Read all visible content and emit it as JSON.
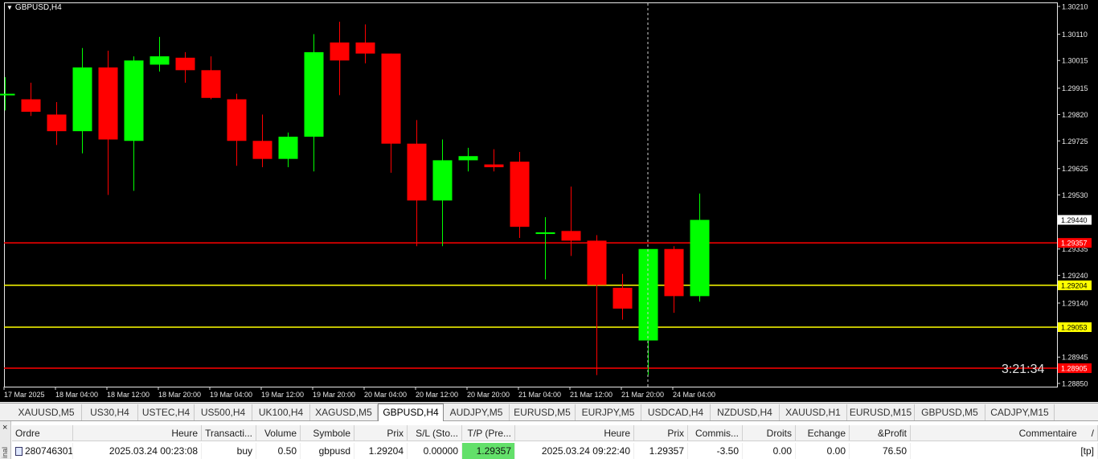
{
  "chart": {
    "symbol_title": "GBPUSD,H4",
    "timer": "3:21:34",
    "colors": {
      "background": "#000000",
      "bull": "#00ff00",
      "bear": "#ff0000",
      "tp_line": "#ff0000",
      "entry_line": "#ffff00",
      "grid": "#ffffff"
    },
    "price_axis": [
      "1.30210",
      "1.30110",
      "1.30015",
      "1.29915",
      "1.29820",
      "1.29725",
      "1.29625",
      "1.29530",
      "1.29441",
      "1.29335",
      "1.29240",
      "1.29140",
      "1.28945",
      "1.28850"
    ],
    "price_tags": [
      {
        "label": "1.29357",
        "price": 1.29357,
        "color": "#ff0000",
        "text": "#ffffff",
        "kind": "tp"
      },
      {
        "label": "1.29204",
        "price": 1.29204,
        "color": "#ffff00",
        "text": "#000000",
        "kind": "entry"
      },
      {
        "label": "1.29053",
        "price": 1.29053,
        "color": "#ffff00",
        "text": "#000000",
        "kind": "entry"
      },
      {
        "label": "1.28905",
        "price": 1.28905,
        "color": "#ff0000",
        "text": "#ffffff",
        "kind": "stop"
      }
    ],
    "time_axis": [
      "17 Mar 2025",
      "18 Mar 04:00",
      "18 Mar 12:00",
      "18 Mar 20:00",
      "19 Mar 04:00",
      "19 Mar 12:00",
      "19 Mar 20:00",
      "20 Mar 04:00",
      "20 Mar 12:00",
      "20 Mar 20:00",
      "21 Mar 04:00",
      "21 Mar 12:00",
      "21 Mar 20:00",
      "24 Mar 04:00"
    ],
    "candles": [
      {
        "o": 1.29895,
        "h": 1.29955,
        "l": 1.29835,
        "c": 1.29895
      },
      {
        "o": 1.29875,
        "h": 1.29935,
        "l": 1.29815,
        "c": 1.2983
      },
      {
        "o": 1.2982,
        "h": 1.29865,
        "l": 1.2971,
        "c": 1.2976
      },
      {
        "o": 1.2976,
        "h": 1.3006,
        "l": 1.2968,
        "c": 1.2999
      },
      {
        "o": 1.2999,
        "h": 1.3005,
        "l": 1.2953,
        "c": 1.2973
      },
      {
        "o": 1.29725,
        "h": 1.3003,
        "l": 1.29545,
        "c": 1.30015
      },
      {
        "o": 1.3,
        "h": 1.301,
        "l": 1.29975,
        "c": 1.3003
      },
      {
        "o": 1.30025,
        "h": 1.30045,
        "l": 1.29935,
        "c": 1.2998
      },
      {
        "o": 1.2998,
        "h": 1.3003,
        "l": 1.29875,
        "c": 1.2988
      },
      {
        "o": 1.29875,
        "h": 1.29895,
        "l": 1.29635,
        "c": 1.29725
      },
      {
        "o": 1.29725,
        "h": 1.2982,
        "l": 1.2963,
        "c": 1.2966
      },
      {
        "o": 1.2966,
        "h": 1.29755,
        "l": 1.2963,
        "c": 1.2974
      },
      {
        "o": 1.2974,
        "h": 1.3011,
        "l": 1.29615,
        "c": 1.30045
      },
      {
        "o": 1.3008,
        "h": 1.30155,
        "l": 1.2989,
        "c": 1.30015
      },
      {
        "o": 1.3008,
        "h": 1.30145,
        "l": 1.30005,
        "c": 1.3004
      },
      {
        "o": 1.3004,
        "h": 1.3004,
        "l": 1.2961,
        "c": 1.29715
      },
      {
        "o": 1.29715,
        "h": 1.298,
        "l": 1.29345,
        "c": 1.2951
      },
      {
        "o": 1.2951,
        "h": 1.2973,
        "l": 1.29345,
        "c": 1.29655
      },
      {
        "o": 1.29655,
        "h": 1.297,
        "l": 1.29615,
        "c": 1.2967
      },
      {
        "o": 1.2964,
        "h": 1.29695,
        "l": 1.29615,
        "c": 1.2963
      },
      {
        "o": 1.2965,
        "h": 1.29685,
        "l": 1.29375,
        "c": 1.29415
      },
      {
        "o": 1.2939,
        "h": 1.2945,
        "l": 1.29225,
        "c": 1.29395
      },
      {
        "o": 1.294,
        "h": 1.2956,
        "l": 1.2931,
        "c": 1.29365
      },
      {
        "o": 1.29365,
        "h": 1.29385,
        "l": 1.2888,
        "c": 1.29205
      },
      {
        "o": 1.29195,
        "h": 1.29245,
        "l": 1.2908,
        "c": 1.2912
      },
      {
        "o": 1.29005,
        "h": 1.29335,
        "l": 1.2888,
        "c": 1.29335
      },
      {
        "o": 1.29335,
        "h": 1.29345,
        "l": 1.29105,
        "c": 1.29165
      },
      {
        "o": 1.29165,
        "h": 1.29535,
        "l": 1.29145,
        "c": 1.2944
      }
    ]
  },
  "tabs": [
    {
      "label": "XAUUSD,M5"
    },
    {
      "label": "US30,H4"
    },
    {
      "label": "USTEC,H4"
    },
    {
      "label": "US500,H4"
    },
    {
      "label": "UK100,H4"
    },
    {
      "label": "XAGUSD,M5"
    },
    {
      "label": "GBPUSD,H4",
      "active": true
    },
    {
      "label": "AUDJPY,M5"
    },
    {
      "label": "EURUSD,M5"
    },
    {
      "label": "EURJPY,M5"
    },
    {
      "label": "USDCAD,H4"
    },
    {
      "label": "NZDUSD,H4"
    },
    {
      "label": "XAUUSD,H1"
    },
    {
      "label": "EURUSD,M15"
    },
    {
      "label": "GBPUSD,M5"
    },
    {
      "label": "CADJPY,M15"
    }
  ],
  "terminal": {
    "close_icon": "×",
    "side_label": "inal",
    "columns": [
      "Ordre",
      "Heure",
      "Transacti...",
      "Volume",
      "Symbole",
      "Prix",
      "S/L (Sto...",
      "T/P (Pre...",
      "Heure",
      "Prix",
      "Commis...",
      "Droits",
      "Echange",
      "&Profit",
      "Commentaire"
    ],
    "sort_marker": "/",
    "row": {
      "order": "280746301",
      "open_time": "2025.03.24 00:23:08",
      "type": "buy",
      "volume": "0.50",
      "symbol": "gbpusd",
      "open_price": "1.29204",
      "sl": "0.00000",
      "tp": "1.29357",
      "close_time": "2025.03.24 09:22:40",
      "close_price": "1.29357",
      "commission": "-3.50",
      "taxes": "0.00",
      "swap": "0.00",
      "profit": "76.50",
      "comment": "[tp]"
    }
  }
}
